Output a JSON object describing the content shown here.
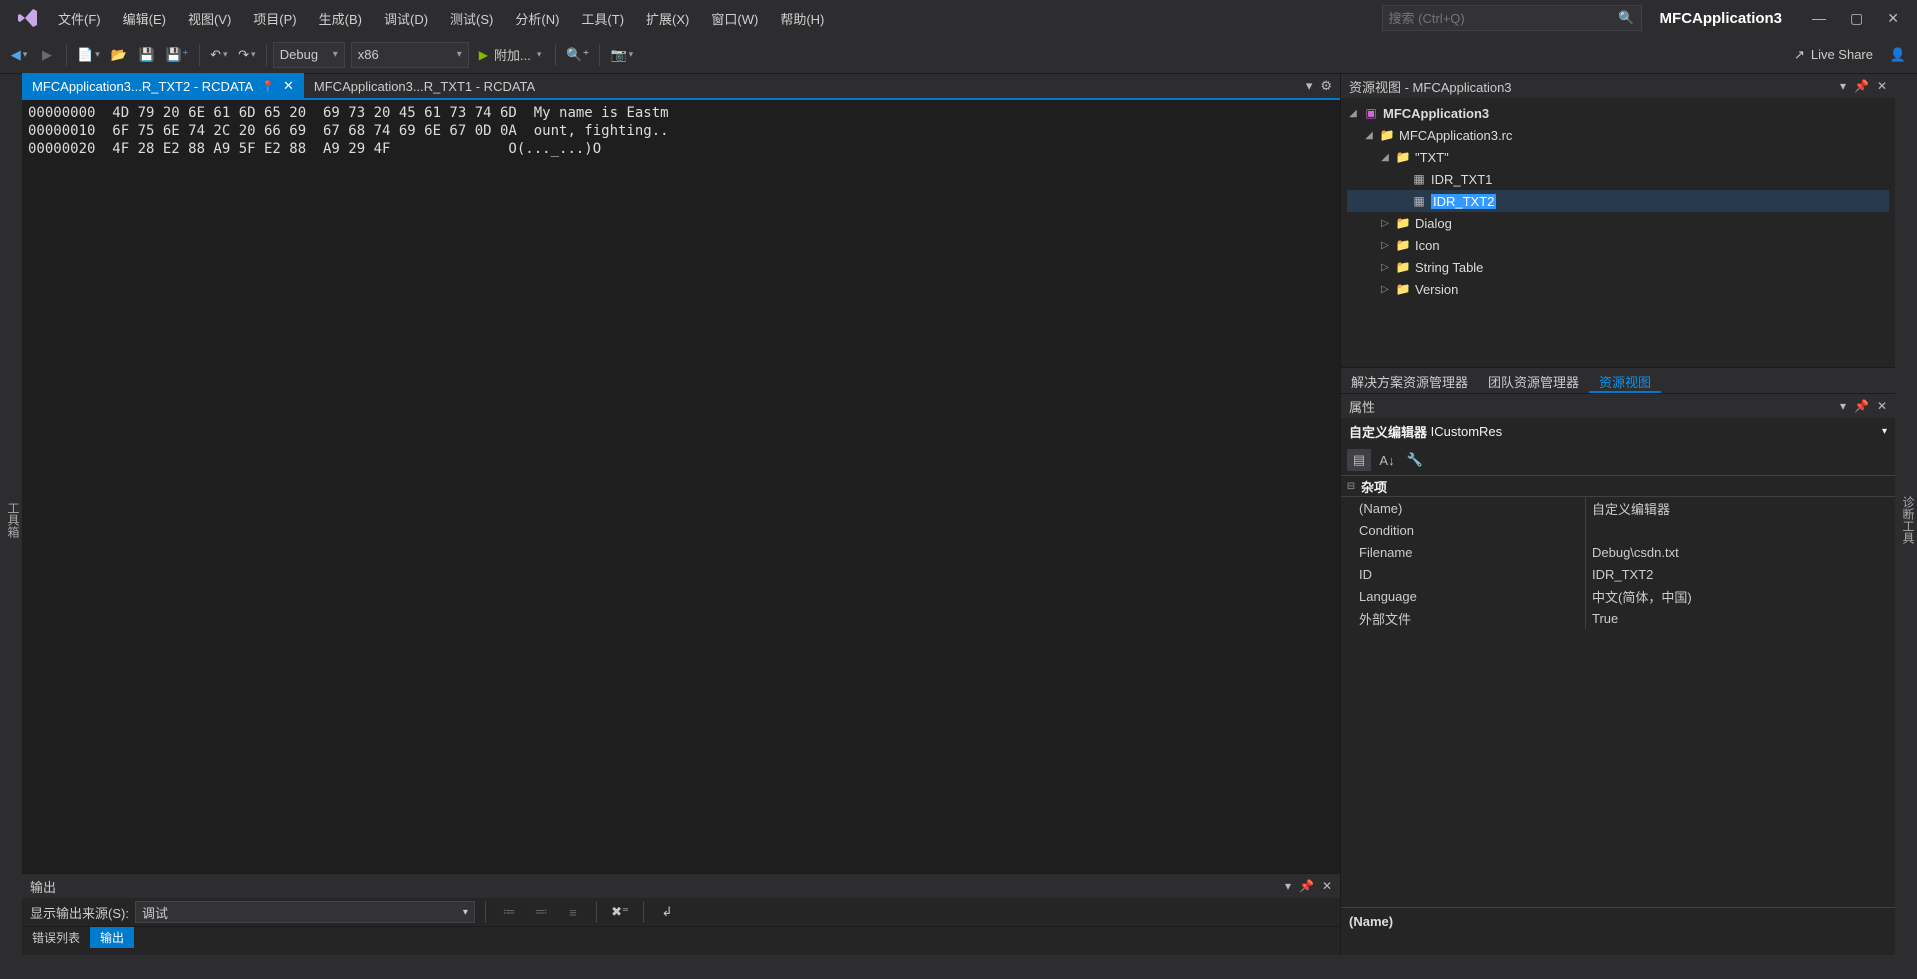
{
  "menu": [
    "文件(F)",
    "编辑(E)",
    "视图(V)",
    "项目(P)",
    "生成(B)",
    "调试(D)",
    "测试(S)",
    "分析(N)",
    "工具(T)",
    "扩展(X)",
    "窗口(W)",
    "帮助(H)"
  ],
  "search_placeholder": "搜索 (Ctrl+Q)",
  "app_name": "MFCApplication3",
  "toolbar": {
    "config": "Debug",
    "platform": "x86",
    "start_label": "附加..."
  },
  "live_share": "Live Share",
  "left_strip": "工具箱",
  "right_strip": "诊断工具",
  "editor_tabs": [
    {
      "label": "MFCApplication3...R_TXT2 - RCDATA",
      "active": true,
      "pinned": true
    },
    {
      "label": "MFCApplication3...R_TXT1 - RCDATA",
      "active": false
    }
  ],
  "hex_lines": [
    {
      "off": "00000000",
      "hex": "4D 79 20 6E 61 6D 65 20  69 73 20 45 61 73 74 6D",
      "asc": "My name is Eastm"
    },
    {
      "off": "00000010",
      "hex": "6F 75 6E 74 2C 20 66 69  67 68 74 69 6E 67 0D 0A",
      "asc": "ount, fighting.."
    },
    {
      "off": "00000020",
      "hex": "4F 28 E2 88 A9 5F E2 88  A9 29 4F            ",
      "asc": "O(..._...)O"
    }
  ],
  "output": {
    "title": "输出",
    "source_label": "显示输出来源(S):",
    "source_value": "调试",
    "tabs": [
      "错误列表",
      "输出"
    ],
    "active_tab": 1
  },
  "resource_view": {
    "title": "资源视图 - MFCApplication3",
    "tree": {
      "root": "MFCApplication3",
      "rc": "MFCApplication3.rc",
      "txt_folder": "\"TXT\"",
      "txt_items": [
        "IDR_TXT1",
        "IDR_TXT2"
      ],
      "selected": "IDR_TXT2",
      "other": [
        "Dialog",
        "Icon",
        "String Table",
        "Version"
      ]
    },
    "bottom_tabs": [
      "解决方案资源管理器",
      "团队资源管理器",
      "资源视图"
    ],
    "active_tab": 2
  },
  "properties": {
    "title": "属性",
    "obj_label": "自定义编辑器",
    "obj_type": "ICustomRes",
    "category": "杂项",
    "rows": [
      {
        "name": "(Name)",
        "value": "自定义编辑器"
      },
      {
        "name": "Condition",
        "value": ""
      },
      {
        "name": "Filename",
        "value": "Debug\\csdn.txt"
      },
      {
        "name": "ID",
        "value": "IDR_TXT2"
      },
      {
        "name": "Language",
        "value": "中文(简体，中国)"
      },
      {
        "name": "外部文件",
        "value": "True"
      }
    ],
    "desc": "(Name)"
  }
}
